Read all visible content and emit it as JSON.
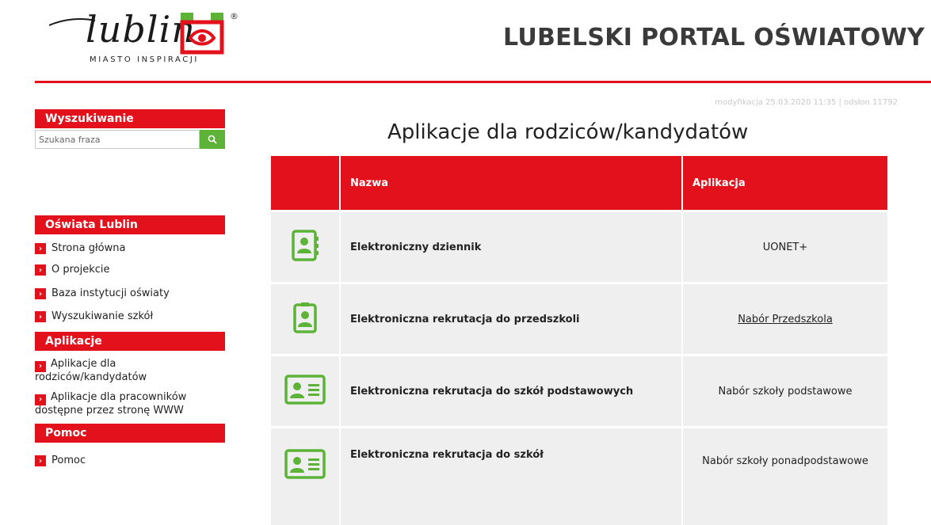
{
  "logo": {
    "wordmark": "lublin",
    "registered": "®",
    "tagline": "MIASTO INSPIRACJI"
  },
  "header": {
    "title": "LUBELSKI PORTAL OŚWIATOWY"
  },
  "meta": {
    "text": "modyfikacja 25.03.2020 11:35 | odsłon 11792"
  },
  "search": {
    "heading": "Wyszukiwanie",
    "placeholder": "Szukana fraza",
    "value": ""
  },
  "nav": {
    "oswiata": {
      "heading": "Oświata Lublin",
      "items": [
        "Strona główna",
        "O projekcie",
        "Baza instytucji oświaty",
        "Wyszukiwanie szkół"
      ]
    },
    "aplikacje": {
      "heading": "Aplikacje",
      "items": [
        "Aplikacje dla rodziców/kandydatów",
        "Aplikacje dla pracowników dostępne przez stronę WWW"
      ]
    },
    "pomoc": {
      "heading": "Pomoc",
      "items": [
        "Pomoc"
      ]
    }
  },
  "page": {
    "title": "Aplikacje dla rodziców/kandydatów"
  },
  "table": {
    "headers": [
      "",
      "Nazwa",
      "Aplikacja"
    ],
    "rows": [
      {
        "icon": "contact-book-icon",
        "name": "Elektroniczny dziennik",
        "app": "UONET+"
      },
      {
        "icon": "id-badge-icon",
        "name": "Elektroniczna rekrutacja do przedszkoli",
        "app": "Nabór Przedszkola"
      },
      {
        "icon": "id-card-icon",
        "name": "Elektroniczna rekrutacja do szkół podstawowych",
        "app": "Nabór szkoły podstawowe"
      },
      {
        "icon": "id-card-icon",
        "name": "Elektroniczna rekrutacja do szkół",
        "app": "Nabór szkoły ponadpodstawowe"
      }
    ]
  },
  "colors": {
    "brand_red": "#e3111b",
    "icon_green": "#5cb338",
    "row_bg": "#efefef"
  }
}
